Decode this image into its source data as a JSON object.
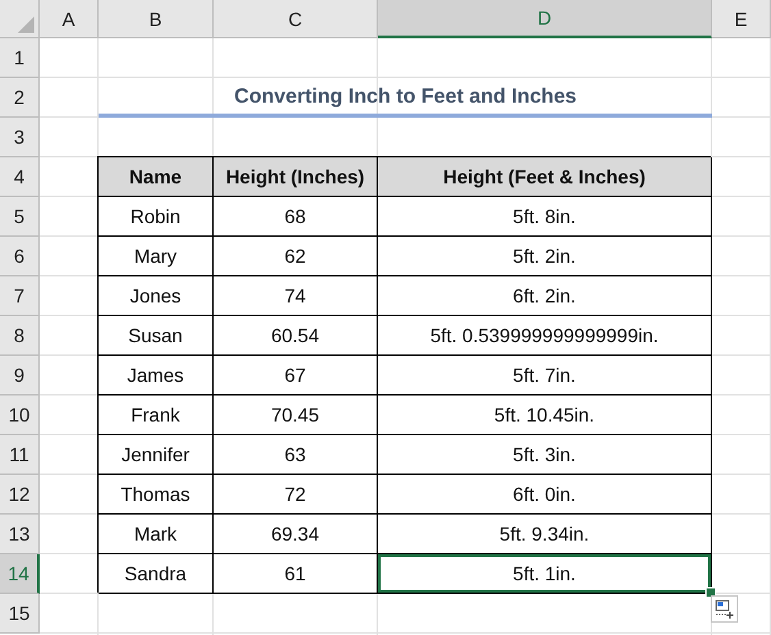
{
  "column_headers": [
    {
      "label": "A",
      "selected": false
    },
    {
      "label": "B",
      "selected": false
    },
    {
      "label": "C",
      "selected": false
    },
    {
      "label": "D",
      "selected": true
    },
    {
      "label": "E",
      "selected": false
    }
  ],
  "row_headers": [
    {
      "label": "1",
      "selected": false
    },
    {
      "label": "2",
      "selected": false
    },
    {
      "label": "3",
      "selected": false
    },
    {
      "label": "4",
      "selected": false
    },
    {
      "label": "5",
      "selected": false
    },
    {
      "label": "6",
      "selected": false
    },
    {
      "label": "7",
      "selected": false
    },
    {
      "label": "8",
      "selected": false
    },
    {
      "label": "9",
      "selected": false
    },
    {
      "label": "10",
      "selected": false
    },
    {
      "label": "11",
      "selected": false
    },
    {
      "label": "12",
      "selected": false
    },
    {
      "label": "13",
      "selected": false
    },
    {
      "label": "14",
      "selected": true
    },
    {
      "label": "15",
      "selected": false
    }
  ],
  "title": "Converting Inch to Feet and Inches",
  "table": {
    "columns": [
      "Name",
      "Height (Inches)",
      "Height (Feet & Inches)"
    ],
    "rows": [
      {
        "cells": [
          {
            "text": "Robin",
            "selected": false
          },
          {
            "text": "68",
            "selected": false
          },
          {
            "text": "5ft. 8in.",
            "selected": false
          }
        ]
      },
      {
        "cells": [
          {
            "text": "Mary",
            "selected": false
          },
          {
            "text": "62",
            "selected": false
          },
          {
            "text": "5ft. 2in.",
            "selected": false
          }
        ]
      },
      {
        "cells": [
          {
            "text": "Jones",
            "selected": false
          },
          {
            "text": "74",
            "selected": false
          },
          {
            "text": "6ft. 2in.",
            "selected": false
          }
        ]
      },
      {
        "cells": [
          {
            "text": "Susan",
            "selected": false
          },
          {
            "text": "60.54",
            "selected": false
          },
          {
            "text": "5ft. 0.539999999999999in.",
            "selected": false
          }
        ]
      },
      {
        "cells": [
          {
            "text": "James",
            "selected": false
          },
          {
            "text": "67",
            "selected": false
          },
          {
            "text": "5ft. 7in.",
            "selected": false
          }
        ]
      },
      {
        "cells": [
          {
            "text": "Frank",
            "selected": false
          },
          {
            "text": "70.45",
            "selected": false
          },
          {
            "text": "5ft. 10.45in.",
            "selected": false
          }
        ]
      },
      {
        "cells": [
          {
            "text": "Jennifer",
            "selected": false
          },
          {
            "text": "63",
            "selected": false
          },
          {
            "text": "5ft. 3in.",
            "selected": false
          }
        ]
      },
      {
        "cells": [
          {
            "text": "Thomas",
            "selected": false
          },
          {
            "text": "72",
            "selected": false
          },
          {
            "text": "6ft. 0in.",
            "selected": false
          }
        ]
      },
      {
        "cells": [
          {
            "text": "Mark",
            "selected": false
          },
          {
            "text": "69.34",
            "selected": false
          },
          {
            "text": "5ft. 9.34in.",
            "selected": false
          }
        ]
      },
      {
        "cells": [
          {
            "text": "Sandra",
            "selected": false
          },
          {
            "text": "61",
            "selected": false
          },
          {
            "text": "5ft. 1in.",
            "selected": true
          }
        ]
      }
    ]
  }
}
